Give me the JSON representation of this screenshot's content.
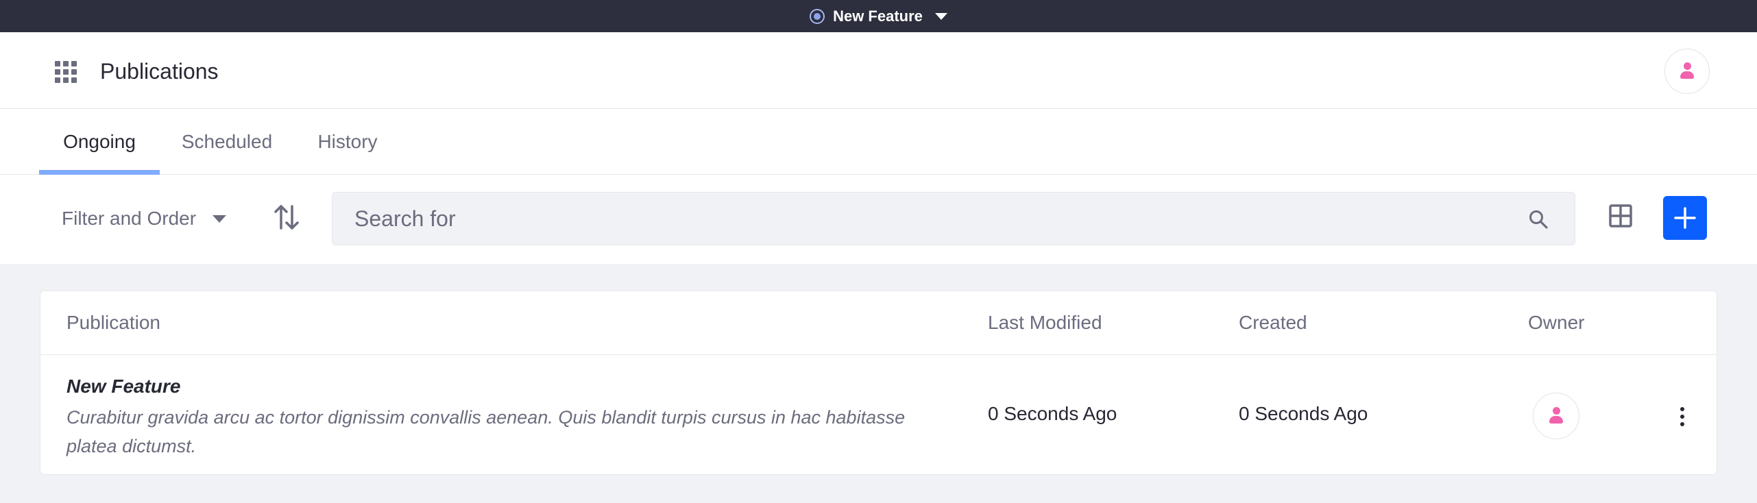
{
  "topbar": {
    "publication_name": "New Feature",
    "status_icon": "circle-dot-icon",
    "dropdown_icon": "caret-down-icon"
  },
  "header": {
    "title": "Publications",
    "menu_icon": "apps-grid-icon",
    "user_icon": "user-avatar-icon"
  },
  "tabs": [
    {
      "label": "Ongoing",
      "active": true
    },
    {
      "label": "Scheduled",
      "active": false
    },
    {
      "label": "History",
      "active": false
    }
  ],
  "toolbar": {
    "filter_label": "Filter and Order",
    "sort_icon": "sort-arrows-icon",
    "search_placeholder": "Search for",
    "search_icon": "search-icon",
    "view_icon": "table-view-icon",
    "add_icon": "plus-icon"
  },
  "table": {
    "columns": [
      "Publication",
      "Last Modified",
      "Created",
      "Owner"
    ],
    "rows": [
      {
        "name": "New Feature",
        "description": "Curabitur gravida arcu ac tortor dignissim convallis aenean. Quis blandit turpis cursus in hac habitasse platea dictumst.",
        "last_modified": "0 Seconds Ago",
        "created": "0 Seconds Ago",
        "owner_icon": "user-avatar-icon",
        "actions_icon": "kebab-menu-icon"
      }
    ]
  },
  "colors": {
    "topbar_bg": "#2d2f3e",
    "accent_primary": "#0b5fff",
    "tab_indicator": "#80acff",
    "avatar_pink": "#f062ad",
    "page_bg": "#f1f2f5"
  }
}
